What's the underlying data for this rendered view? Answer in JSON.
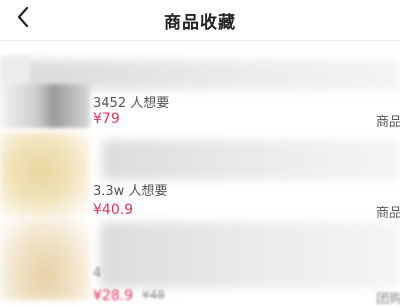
{
  "header": {
    "title": "商品收藏"
  },
  "products": [
    {
      "want_text": "3452 人想要",
      "price": "¥79",
      "tag": "商品"
    },
    {
      "want_text": "3.3w 人想要",
      "price": "¥40.9",
      "tag": "商品"
    },
    {
      "want_text": "4",
      "price": "¥28.9",
      "original_price": "¥48",
      "tag": "团购"
    }
  ],
  "colors": {
    "price": "#e0345a",
    "text": "#555555",
    "title": "#222222"
  }
}
